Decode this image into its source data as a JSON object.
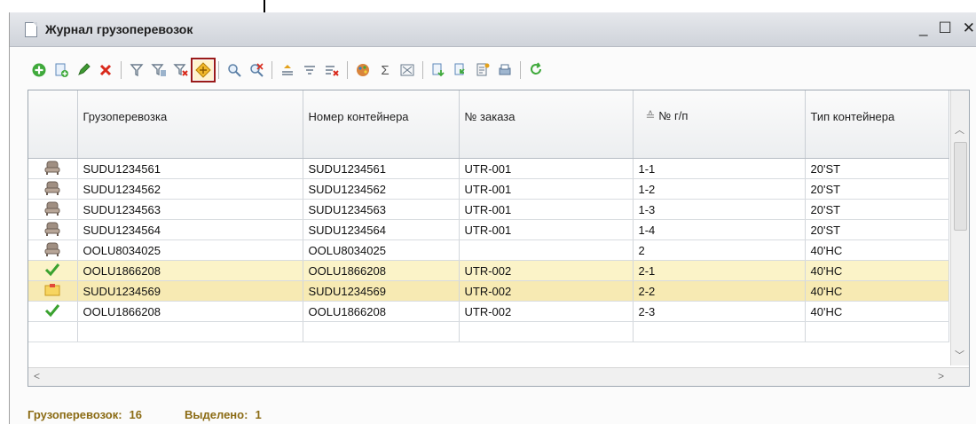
{
  "window": {
    "title": "Журнал грузоперевозок",
    "controls": [
      "_",
      "☐",
      "✕"
    ]
  },
  "toolbar": {
    "buttons": [
      {
        "name": "add-icon",
        "glyph": "⊕"
      },
      {
        "name": "copy-icon",
        "glyph": "⎘"
      },
      {
        "name": "edit-icon",
        "glyph": "✎"
      },
      {
        "name": "delete-icon",
        "glyph": "✖"
      },
      {
        "name": "filter-icon",
        "glyph": "⊽"
      },
      {
        "name": "filter-list-icon",
        "glyph": "⊽"
      },
      {
        "name": "filter-clear-icon",
        "glyph": "⊽"
      },
      {
        "name": "filter-selected-value-icon",
        "glyph": "◈"
      },
      {
        "name": "find-icon",
        "glyph": "⌕"
      },
      {
        "name": "find-cancel-icon",
        "glyph": "⌕"
      },
      {
        "name": "sort-asc-icon",
        "glyph": "≙"
      },
      {
        "name": "sort-desc-icon",
        "glyph": "≘"
      },
      {
        "name": "sort-clear-icon",
        "glyph": "≡"
      },
      {
        "name": "appearance-icon",
        "glyph": "✱"
      },
      {
        "name": "sum-icon",
        "glyph": "Σ"
      },
      {
        "name": "output-list-icon",
        "glyph": "⊠"
      },
      {
        "name": "import-icon",
        "glyph": "⇓"
      },
      {
        "name": "export-icon",
        "glyph": "⇑"
      },
      {
        "name": "report-icon",
        "glyph": "▤"
      },
      {
        "name": "print-icon",
        "glyph": "⎙"
      },
      {
        "name": "refresh-icon",
        "glyph": "↻"
      }
    ]
  },
  "table": {
    "columns": [
      "",
      "Грузоперевозка",
      "Номер контейнера",
      "№ заказа",
      "№ г/п",
      "Тип контейнера"
    ],
    "rows": [
      {
        "icon": "seat",
        "c1": "SUDU1234561",
        "c2": "SUDU1234561",
        "c3": "UTR-001",
        "c4": "1-1",
        "c5": "20'ST",
        "style": ""
      },
      {
        "icon": "seat",
        "c1": "SUDU1234562",
        "c2": "SUDU1234562",
        "c3": "UTR-001",
        "c4": "1-2",
        "c5": "20'ST",
        "style": ""
      },
      {
        "icon": "seat",
        "c1": "SUDU1234563",
        "c2": "SUDU1234563",
        "c3": "UTR-001",
        "c4": "1-3",
        "c5": "20'ST",
        "style": ""
      },
      {
        "icon": "seat",
        "c1": "SUDU1234564",
        "c2": "SUDU1234564",
        "c3": "UTR-001",
        "c4": "1-4",
        "c5": "20'ST",
        "style": ""
      },
      {
        "icon": "seat",
        "c1": "OOLU8034025",
        "c2": "OOLU8034025",
        "c3": "",
        "c4": "2",
        "c5": "40'HC",
        "style": ""
      },
      {
        "icon": "check",
        "c1": "OOLU1866208",
        "c2": "OOLU1866208",
        "c3": "UTR-002",
        "c4": "2-1",
        "c5": "40'HC",
        "style": "yellow"
      },
      {
        "icon": "folder",
        "c1": "SUDU1234569",
        "c2": "SUDU1234569",
        "c3": "UTR-002",
        "c4": "2-2",
        "c5": "40'HC",
        "style": "yellow-sel"
      },
      {
        "icon": "check",
        "c1": "OOLU1866208",
        "c2": "OOLU1866208",
        "c3": "UTR-002",
        "c4": "2-3",
        "c5": "40'HC",
        "style": ""
      }
    ]
  },
  "status": {
    "count_label": "Грузоперевозок:",
    "count_value": "16",
    "selected_label": "Выделено:",
    "selected_value": "1"
  },
  "colors": {
    "status_text": "#8b6b14",
    "highlight_border": "#9a1a1a",
    "row_yellow": "#fbf3c8"
  }
}
